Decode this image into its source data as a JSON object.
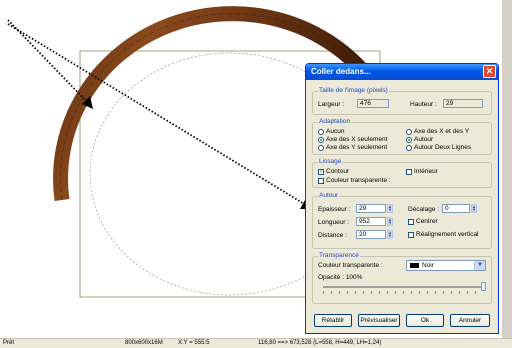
{
  "dialog": {
    "title": "Coller dedans...",
    "groups": {
      "size": {
        "legend": "Taille de l'image (pixels)",
        "width_label": "Largeur :",
        "width_value": "476",
        "height_label": "Hauteur :",
        "height_value": "29"
      },
      "adaptation": {
        "legend": "Adaptation",
        "options": [
          "Aucun",
          "Axe des X seulement",
          "Axe des Y seulement",
          "Axe des X et des Y",
          "Autour",
          "Autour Deux Lignes"
        ],
        "selected": [
          "Axe des X seulement",
          "Autour"
        ]
      },
      "smoothing": {
        "legend": "Lissage",
        "contour_label": "Contour",
        "contour_checked": true,
        "interior_label": "Intérieur",
        "interior_checked": false,
        "transparent_label": "Couleur transparente :",
        "transparent_checked": false
      },
      "around": {
        "legend": "Autour",
        "thickness_label": "Epaisseur :",
        "thickness_value": "29",
        "length_label": "Longueur :",
        "length_value": "952",
        "distance_label": "Distance :",
        "distance_value": "20",
        "offset_label": "Décalage :",
        "offset_value": "0",
        "center_label": "Centrer",
        "realign_label": "Réalignement vertical"
      },
      "transparency": {
        "legend": "Transparence",
        "color_label": "Couleur transparente :",
        "color_value": "Noir",
        "opacity_label": "Opacité : 100%",
        "opacity_level": 1.0
      }
    },
    "buttons": {
      "reset": "Rétablir",
      "preview": "Prévisualiser",
      "ok": "Ok",
      "cancel": "Annuler"
    },
    "close_icon": "close-icon"
  },
  "status_bar": {
    "state": "Prêt",
    "image_info": "800x600x16M",
    "cursor": "X:Y = 555:5",
    "selection": "116,80 ==> 673,528 (L=558, H=449, LH=1,24)"
  },
  "colors": {
    "accent": "#0058e6",
    "dialog_bg": "#ece9d8",
    "wood": "#6b3513",
    "transparent_color": "#000000"
  }
}
